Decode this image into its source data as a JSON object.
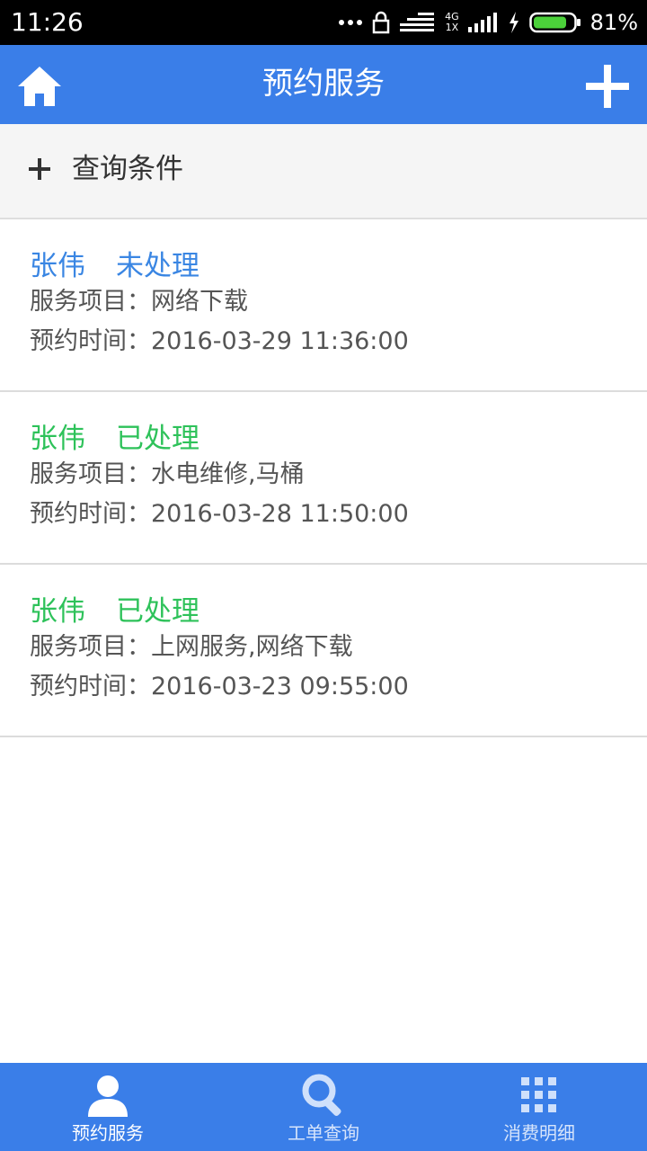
{
  "status_bar": {
    "time": "11:26",
    "network_type": "4G",
    "network_sub": "1X",
    "battery_percent": "81%",
    "battery_level": 0.81
  },
  "app_bar": {
    "title": "预约服务",
    "left_icon": "home-icon",
    "right_icon": "plus-icon"
  },
  "query": {
    "icon": "plus-icon",
    "label": "查询条件"
  },
  "appointments": [
    {
      "name": "张伟",
      "status": "未处理",
      "status_color": "#3a86e3",
      "service": "服务项目：网络下载",
      "time": "预约时间：2016-03-29 11:36:00"
    },
    {
      "name": "张伟",
      "status": "已处理",
      "status_color": "#2ec25a",
      "service": "服务项目：水电维修,马桶",
      "time": "预约时间：2016-03-28 11:50:00"
    },
    {
      "name": "张伟",
      "status": "已处理",
      "status_color": "#2ec25a",
      "service": "服务项目：上网服务,网络下载",
      "time": "预约时间：2016-03-23 09:55:00"
    }
  ],
  "bottom_nav": {
    "tabs": [
      {
        "label": "预约服务",
        "icon": "person-icon",
        "active": true
      },
      {
        "label": "工单查询",
        "icon": "search-icon",
        "active": false
      },
      {
        "label": "消费明细",
        "icon": "grid-icon",
        "active": false
      }
    ]
  },
  "colors": {
    "primary": "#3a7ee8",
    "pending": "#3a86e3",
    "done": "#2ec25a",
    "nav_active_text": "#ffffff",
    "nav_inactive_text": "#d6e4fb"
  }
}
